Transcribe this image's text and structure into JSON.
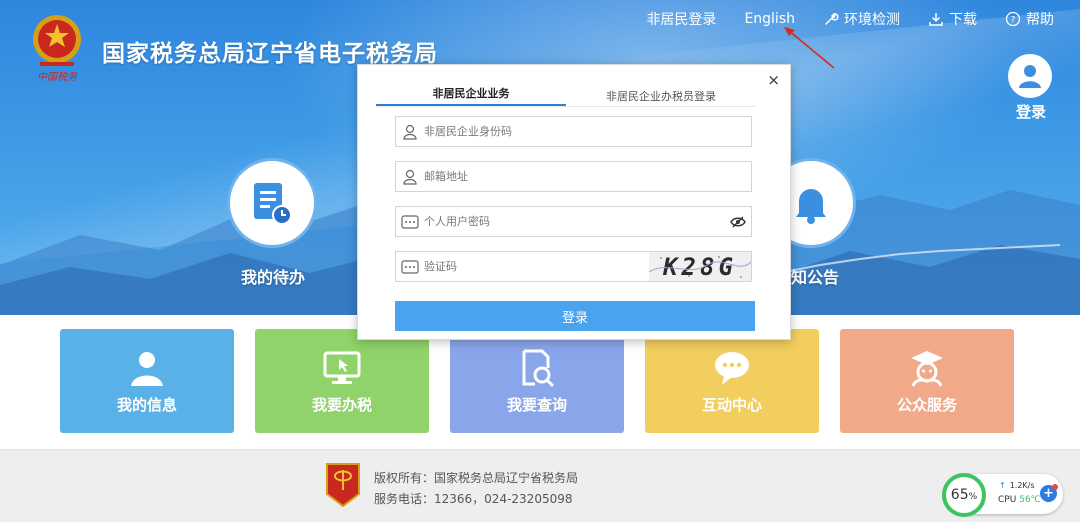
{
  "header": {
    "site_title": "国家税务总局辽宁省电子税务局",
    "nav": [
      {
        "label": "非居民登录",
        "icon": ""
      },
      {
        "label": "English",
        "icon": ""
      },
      {
        "label": "环境检测",
        "icon": "wrench-icon"
      },
      {
        "label": "下载",
        "icon": "download-icon"
      },
      {
        "label": "帮助",
        "icon": "help-icon"
      }
    ],
    "login_label": "登录"
  },
  "hero": {
    "left_label": "我的待办",
    "right_label": "知公告"
  },
  "dialog": {
    "tabs": [
      {
        "label": "非居民企业业务",
        "active": true
      },
      {
        "label": "非居民企业办税员登录",
        "active": false
      }
    ],
    "fields": {
      "id_placeholder": "非居民企业身份码",
      "email_placeholder": "邮箱地址",
      "password_placeholder": "个人用户密码",
      "captcha_placeholder": "验证码"
    },
    "captcha_text": "K28G",
    "submit_label": "登录",
    "close_symbol": "×"
  },
  "tiles": [
    {
      "label": "我的信息",
      "color": "#5ab1e8",
      "icon": "user-icon"
    },
    {
      "label": "我要办税",
      "color": "#8fd36a",
      "icon": "monitor-icon"
    },
    {
      "label": "我要查询",
      "color": "#8aa6ea",
      "icon": "search-doc-icon"
    },
    {
      "label": "互动中心",
      "color": "#f2ce5e",
      "icon": "chat-icon"
    },
    {
      "label": "公众服务",
      "color": "#f2a98a",
      "icon": "service-icon"
    }
  ],
  "footer": {
    "copyright": "版权所有：国家税务总局辽宁省税务局",
    "phone": "服务电话：12366，024-23205098"
  },
  "perf_widget": {
    "percent": "65",
    "percent_unit": "%",
    "speed": "1.2K/s",
    "cpu_label": "CPU",
    "cpu_temp": "56℃"
  }
}
